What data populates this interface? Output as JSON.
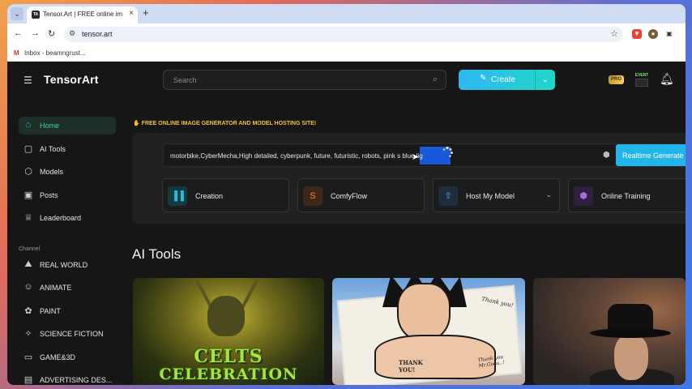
{
  "browser": {
    "tab_title": "Tensor.Art | FREE online image g",
    "tab_close": "×",
    "new_tab": "+",
    "url": "tensor.art",
    "bookmark_label": "Inbox - beamngrust...",
    "icons": [
      "tab-search-icon",
      "back-icon",
      "forward-icon",
      "reload-icon",
      "site-info-icon",
      "bookmark-star-icon",
      "extension-icons"
    ]
  },
  "app": {
    "logo": "TensorArt",
    "search_placeholder": "Search",
    "create_label": "Create",
    "pro_label": "PRO",
    "event_label": "EVENT",
    "accent": "#22c1d8"
  },
  "sidebar": {
    "items": [
      {
        "label": "Home",
        "icon": "home-icon"
      },
      {
        "label": "AI Tools",
        "icon": "ai-tools-icon"
      },
      {
        "label": "Models",
        "icon": "models-icon"
      },
      {
        "label": "Posts",
        "icon": "posts-icon"
      },
      {
        "label": "Leaderboard",
        "icon": "trophy-icon"
      }
    ],
    "channel_heading": "Channel",
    "channels": [
      {
        "label": "REAL WORLD",
        "icon": "real-world-icon"
      },
      {
        "label": "ANIMATE",
        "icon": "animate-icon"
      },
      {
        "label": "PAINT",
        "icon": "paint-icon"
      },
      {
        "label": "SCIENCE FICTION",
        "icon": "science-fiction-icon"
      },
      {
        "label": "GAME&3D",
        "icon": "game-icon"
      },
      {
        "label": "ADVERTISING DES...",
        "icon": "advertising-icon"
      }
    ]
  },
  "main": {
    "banner": "FREE ONLINE IMAGE GENERATOR AND MODEL HOSTING SITE!",
    "prompt_text": "motorbike,CyberMecha,High detailed, cyberpunk, future, futuristic, robots, pink s blue lig",
    "realtime_label": "Realtime Generate",
    "cards": [
      {
        "label": "Creation",
        "icon": "creation-icon",
        "color": "#22c1d8"
      },
      {
        "label": "ComfyFlow",
        "icon": "comfyflow-icon",
        "color": "#f08a3a"
      },
      {
        "label": "Host My Model",
        "icon": "upload-icon",
        "color": "#5aa9f0"
      },
      {
        "label": "Online Training",
        "icon": "cube-icon",
        "color": "#a46be0"
      }
    ],
    "section_title": "AI Tools",
    "thumbnails": [
      {
        "title_line1": "CELTS",
        "title_line2": "CELEBRATION"
      },
      {
        "note_1": "Thank you!",
        "note_2": "THANK YOU!",
        "note_3": "Thank you Mr.Goou..!"
      },
      {}
    ]
  }
}
